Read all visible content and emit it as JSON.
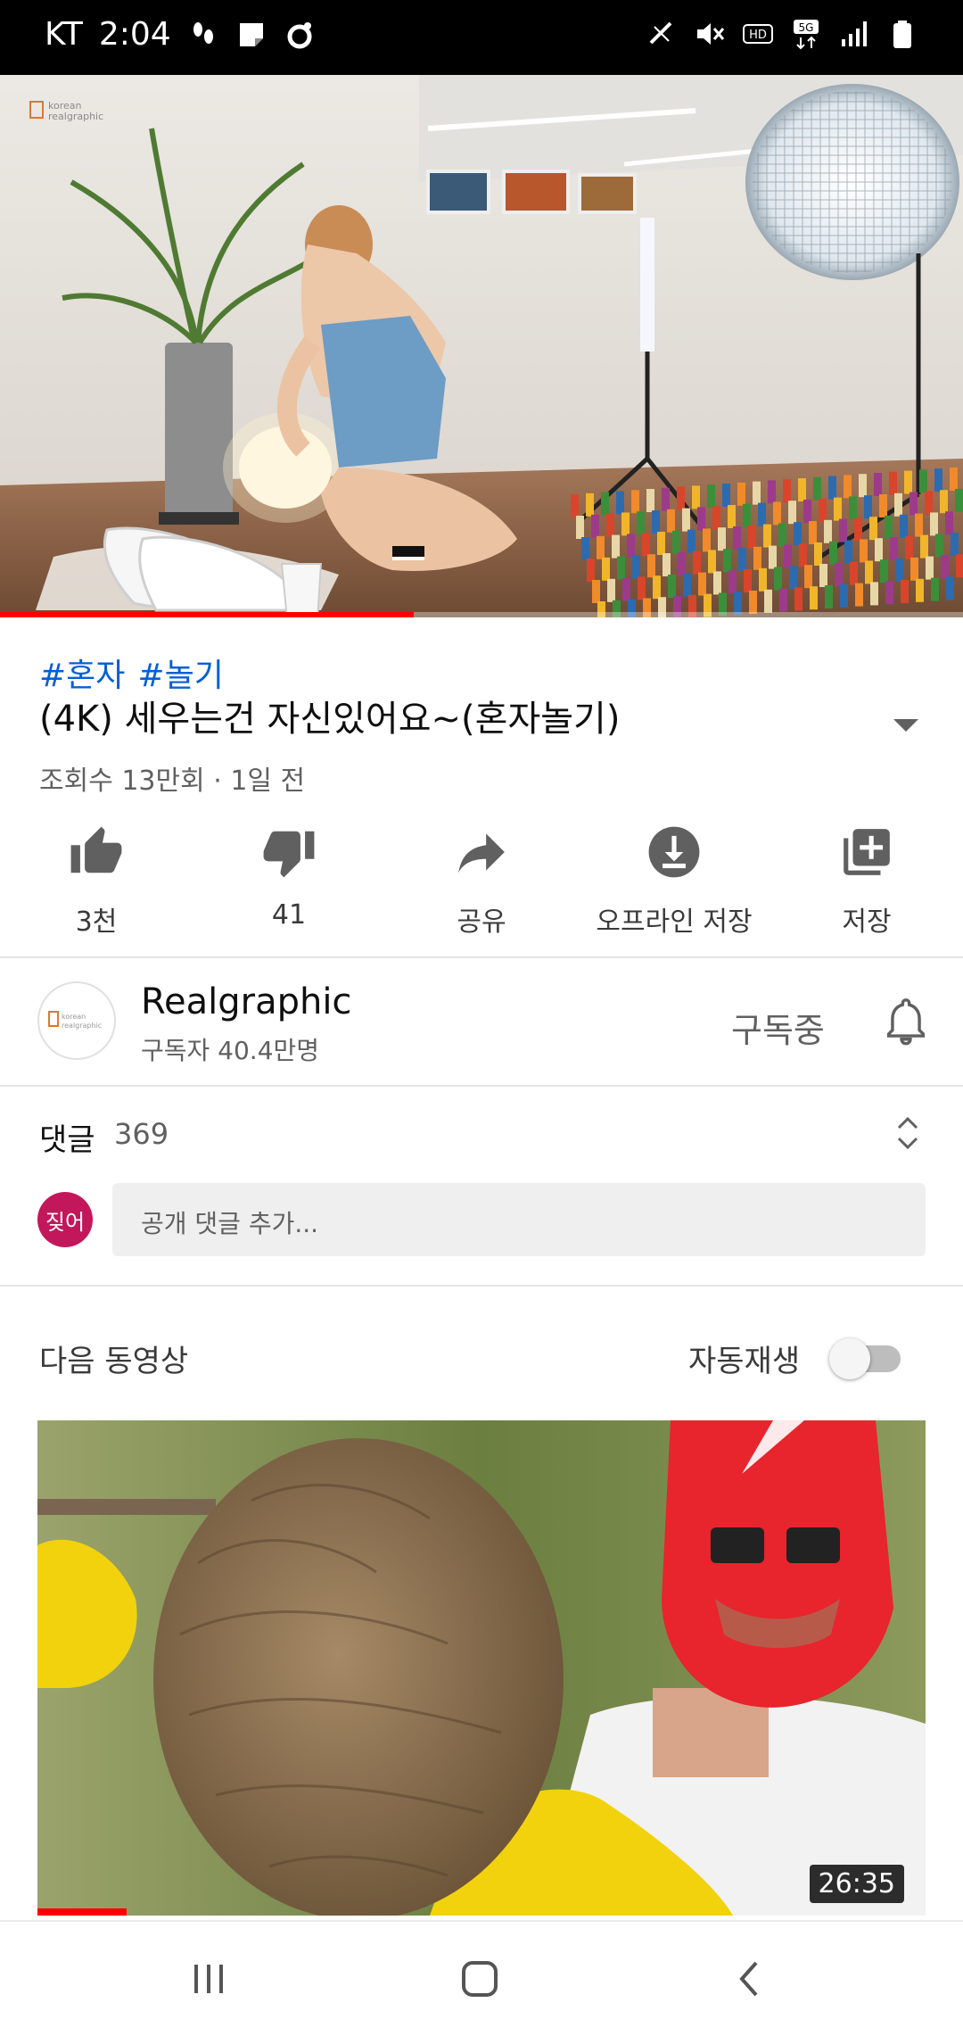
{
  "status_bar": {
    "carrier": "KT",
    "time": "2:04"
  },
  "video": {
    "watermark": "korean realgraphic",
    "progress_fraction": 0.43
  },
  "hashtags": [
    "#혼자",
    "#놀기"
  ],
  "title": "(4K) 세우는건 자신있어요~(혼자놀기)",
  "meta": "조회수 13만회 · 1일 전",
  "actions": [
    {
      "label": "3천",
      "icon": "thumbs-up-icon"
    },
    {
      "label": "41",
      "icon": "thumbs-down-icon"
    },
    {
      "label": "공유",
      "icon": "share-icon"
    },
    {
      "label": "오프라인 저장",
      "icon": "download-icon"
    },
    {
      "label": "저장",
      "icon": "add-to-playlist-icon"
    }
  ],
  "channel": {
    "name": "Realgraphic",
    "subscribers": "구독자 40.4만명",
    "subscribed_label": "구독중",
    "avatar_text": "korean realgraphic"
  },
  "comments": {
    "label": "댓글",
    "count": "369",
    "user_avatar_text": "짖어",
    "placeholder": "공개 댓글 추가..."
  },
  "up_next": {
    "label": "다음 동영상",
    "autoplay_label": "자동재생",
    "autoplay_on": false,
    "duration": "26:35",
    "progress_fraction": 0.1
  },
  "colors": {
    "accent_red": "#ff0000",
    "hashtag_blue": "#065fd4",
    "user_avatar": "#c2185b"
  }
}
